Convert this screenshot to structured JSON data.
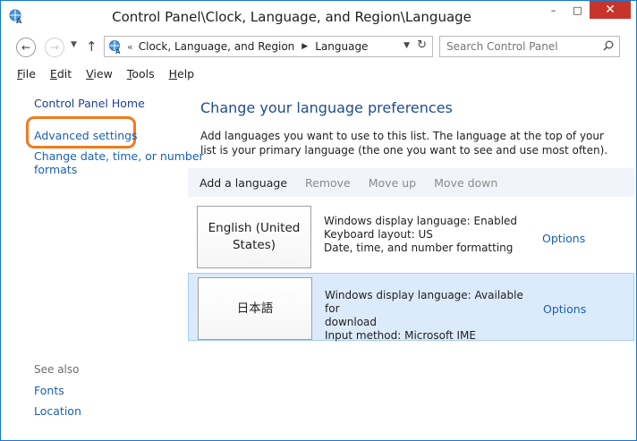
{
  "window": {
    "title": "Control Panel\\Clock, Language, and Region\\Language",
    "controls": {
      "minimize": "–",
      "maximize": "□",
      "close": "✕"
    }
  },
  "address": {
    "overflow": "«",
    "crumbs": [
      "Clock, Language, and Region",
      "Language"
    ],
    "separator": "▶",
    "search_placeholder": "Search Control Panel"
  },
  "menu": [
    "File",
    "Edit",
    "View",
    "Tools",
    "Help"
  ],
  "sidebar": {
    "home": "Control Panel Home",
    "advanced": "Advanced settings",
    "change_date_1": "Change date, time, or number",
    "change_date_2": "formats",
    "see_also": "See also",
    "fonts": "Fonts",
    "location": "Location"
  },
  "main": {
    "title": "Change your language preferences",
    "description": "Add languages you want to use to this list. The language at the top of your list is your primary language (the one you want to see and use most often).",
    "toolbar": {
      "add": "Add a language",
      "remove": "Remove",
      "move_up": "Move up",
      "move_down": "Move down"
    },
    "languages": [
      {
        "name_1": "English (United",
        "name_2": "States)",
        "line1": "Windows display language: Enabled",
        "line2": "Keyboard layout: US",
        "line3": "Date, time, and number formatting",
        "options": "Options"
      },
      {
        "name": "日本語",
        "line1": "Windows display language: Available for",
        "line2": "download",
        "line3": "Input method: Microsoft IME",
        "options": "Options"
      }
    ]
  },
  "colors": {
    "link": "#1a5fb4",
    "title": "#1e4e8c",
    "selected_row": "#dcebfc",
    "highlight": "#f07b1c",
    "close": "#c7342b"
  }
}
